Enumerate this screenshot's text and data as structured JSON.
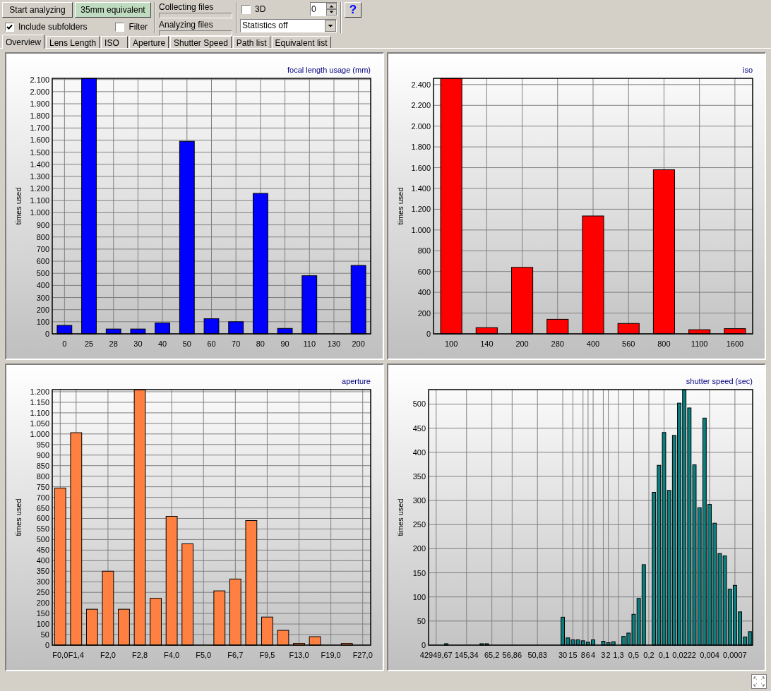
{
  "toolbar": {
    "buttons": [
      {
        "label": "Start analyzing",
        "kind": "plain"
      },
      {
        "label": "35mm equivalent",
        "kind": "highlight"
      }
    ],
    "options": [
      {
        "label": "Include subfolders",
        "checked": true
      },
      {
        "label": "Filter",
        "checked": false
      }
    ],
    "progress": [
      {
        "label": "Collecting files",
        "level": 0
      },
      {
        "label": "Analyzing files",
        "level": 0
      }
    ],
    "three_d": {
      "label": "3D",
      "checked": false
    },
    "spin_value": "0",
    "statistics_dropdown": "Statistics off",
    "help_button": "?"
  },
  "tabs": [
    {
      "label": "Overview",
      "selected": true
    },
    {
      "label": "Lens Length",
      "selected": false
    },
    {
      "label": "ISO",
      "selected": false
    },
    {
      "label": "Aperture",
      "selected": false
    },
    {
      "label": "Shutter Speed",
      "selected": false
    },
    {
      "label": "Path list",
      "selected": false
    },
    {
      "label": "Equivalent list",
      "selected": false
    }
  ],
  "charts": [
    {
      "chart_data": {
        "type": "bar",
        "title": "focal length usage (mm)",
        "ylabel": "times used",
        "grid": true,
        "categories": [
          "0",
          "25",
          "28",
          "30",
          "40",
          "50",
          "60",
          "70",
          "80",
          "90",
          "110",
          "130",
          "200"
        ],
        "series": [
          {
            "color": "#0000ff",
            "values": [
              70,
              2110,
              40,
              40,
              90,
              1590,
              125,
              100,
              1160,
              45,
              480,
              0,
              565
            ]
          }
        ],
        "ylim": [
          0,
          2110
        ],
        "yticks": [
          0,
          100,
          200,
          300,
          400,
          500,
          600,
          700,
          800,
          900,
          {
            "value": 1000,
            "label": "1.000"
          },
          {
            "value": 1100,
            "label": "1.100"
          },
          {
            "value": 1200,
            "label": "1.200"
          },
          {
            "value": 1300,
            "label": "1.300"
          },
          {
            "value": 1400,
            "label": "1.400"
          },
          {
            "value": 1500,
            "label": "1.500"
          },
          {
            "value": 1600,
            "label": "1.600"
          },
          {
            "value": 1700,
            "label": "1.700"
          },
          {
            "value": 1800,
            "label": "1.800"
          },
          {
            "value": 1900,
            "label": "1.900"
          },
          {
            "value": 2000,
            "label": "2.000"
          },
          {
            "value": 2100,
            "label": "2.100"
          }
        ]
      }
    },
    {
      "chart_data": {
        "type": "bar",
        "title": "iso",
        "ylabel": "times used",
        "grid": true,
        "categories": [
          "100",
          "140",
          "200",
          "280",
          "400",
          "560",
          "800",
          "1100",
          "1600"
        ],
        "series": [
          {
            "color": "#ff0000",
            "values": [
              2460,
              60,
              640,
              140,
              1135,
              100,
              1580,
              40,
              50
            ]
          }
        ],
        "ylim": [
          0,
          2460
        ],
        "yticks": [
          0,
          200,
          400,
          600,
          800,
          {
            "value": 1000,
            "label": "1.000"
          },
          {
            "value": 1200,
            "label": "1.200"
          },
          {
            "value": 1400,
            "label": "1.400"
          },
          {
            "value": 1600,
            "label": "1.600"
          },
          {
            "value": 1800,
            "label": "1.800"
          },
          {
            "value": 2000,
            "label": "2.000"
          },
          {
            "value": 2200,
            "label": "2.200"
          },
          {
            "value": 2400,
            "label": "2.400"
          }
        ]
      }
    },
    {
      "chart_data": {
        "type": "bar",
        "title": "aperture",
        "ylabel": "times used",
        "grid": true,
        "categories": [
          "F0,0",
          "F1,4",
          null,
          "F2,0",
          null,
          "F2,8",
          null,
          "F4,0",
          null,
          "F5,0",
          null,
          "F6,7",
          null,
          "F9,5",
          null,
          "F13,0",
          null,
          "F19,0",
          null,
          "F27,0"
        ],
        "series": [
          {
            "color": "#ff8040",
            "values": [
              744,
              1006,
              170,
              350,
              170,
              1210,
              222,
              610,
              480,
              0,
              257,
              313,
              590,
              133,
              70,
              8,
              40,
              0,
              8,
              0
            ]
          }
        ],
        "ylim": [
          0,
          1210
        ],
        "yticks": [
          0,
          50,
          100,
          150,
          200,
          250,
          300,
          350,
          400,
          450,
          500,
          550,
          600,
          650,
          700,
          750,
          800,
          850,
          900,
          950,
          {
            "value": 1000,
            "label": "1.000"
          },
          {
            "value": 1050,
            "label": "1.050"
          },
          {
            "value": 1100,
            "label": "1.100"
          },
          {
            "value": 1150,
            "label": "1.150"
          },
          {
            "value": 1200,
            "label": "1.200"
          }
        ]
      }
    },
    {
      "chart_data": {
        "type": "bar",
        "title": "shutter speed (sec)",
        "ylabel": "times used",
        "grid": true,
        "categories": [
          null,
          "42949,67",
          null,
          null,
          null,
          null,
          null,
          "145,34",
          null,
          null,
          null,
          null,
          "65,2",
          null,
          null,
          null,
          "56,86",
          null,
          null,
          null,
          null,
          "50,83",
          null,
          null,
          null,
          null,
          "30",
          null,
          "15",
          null,
          "8",
          "6",
          "4",
          null,
          "3",
          "2",
          null,
          "1,3",
          null,
          null,
          "0,5",
          null,
          null,
          "0,2",
          null,
          null,
          "0,1",
          null,
          null,
          null,
          "0,0222",
          null,
          null,
          null,
          null,
          "0,004",
          null,
          null,
          null,
          null,
          "0,0007",
          null,
          null,
          null
        ],
        "series": [
          {
            "color": "#0a7f7f",
            "values": [
              0,
              0,
              0,
              3,
              0,
              0,
              0,
              0,
              0,
              0,
              3,
              3,
              0,
              0,
              0,
              0,
              0,
              0,
              0,
              0,
              0,
              0,
              0,
              0,
              0,
              0,
              58,
              15,
              11,
              11,
              9,
              6,
              11,
              0,
              8,
              5,
              7,
              0,
              18,
              25,
              64,
              97,
              167,
              0,
              317,
              373,
              441,
              321,
              435,
              502,
              530,
              492,
              374,
              285,
              471,
              292,
              253,
              190,
              185,
              116,
              124,
              69,
              17,
              28
            ]
          }
        ],
        "ylim": [
          0,
          530
        ],
        "yticks": [
          0,
          50,
          100,
          150,
          200,
          250,
          300,
          350,
          400,
          450,
          500
        ]
      }
    }
  ]
}
